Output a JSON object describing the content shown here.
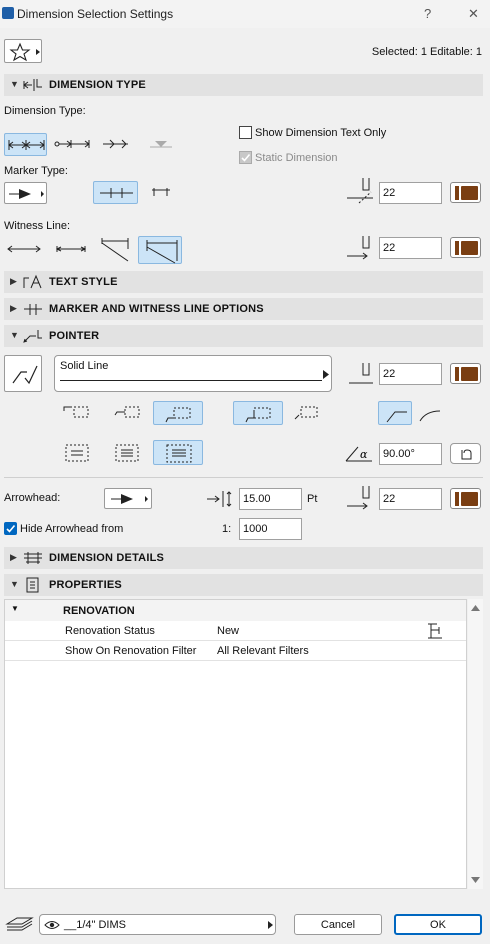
{
  "window": {
    "title": "Dimension Selection Settings",
    "help": "?",
    "close": "✕"
  },
  "header": {
    "selection_info": "Selected: 1 Editable: 1"
  },
  "sections": {
    "dimension_type": "DIMENSION TYPE",
    "text_style": "TEXT STYLE",
    "marker_witness": "MARKER AND WITNESS LINE OPTIONS",
    "pointer": "POINTER",
    "dimension_details": "DIMENSION DETAILS",
    "properties": "PROPERTIES"
  },
  "dimension": {
    "type_label": "Dimension Type:",
    "show_text_only": "Show Dimension Text Only",
    "static_dimension": "Static Dimension",
    "marker_type_label": "Marker Type:",
    "marker_pen": "22",
    "witness_label": "Witness Line:",
    "witness_pen": "22"
  },
  "pointer": {
    "line_type": "Solid Line",
    "pen": "22",
    "angle": "90.00°"
  },
  "arrowhead": {
    "label": "Arrowhead:",
    "size": "15.00",
    "unit": "Pt",
    "pen": "22",
    "hide_label": "Hide Arrowhead from",
    "scale_prefix": "1:",
    "scale": "1000"
  },
  "properties": {
    "group": "RENOVATION",
    "rows": [
      {
        "name": "Renovation Status",
        "value": "New"
      },
      {
        "name": "Show On Renovation Filter",
        "value": "All Relevant Filters"
      }
    ]
  },
  "footer": {
    "layer": "__1/4\" DIMS",
    "cancel": "Cancel",
    "ok": "OK"
  },
  "colors": {
    "pen_swatch": "#7a3e12",
    "selected_bg": "#cce4f7",
    "section_bg": "#e2e2e2"
  }
}
